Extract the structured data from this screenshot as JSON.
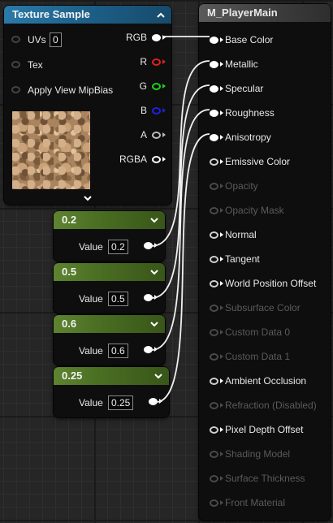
{
  "texture_node": {
    "title": "Texture Sample",
    "inputs": [
      {
        "label": "UVs",
        "value": "0"
      },
      {
        "label": "Tex"
      },
      {
        "label": "Apply View MipBias"
      }
    ],
    "outputs": [
      {
        "label": "RGB",
        "color": "#ffffff"
      },
      {
        "label": "R",
        "color": "#e02020"
      },
      {
        "label": "G",
        "color": "#20d020"
      },
      {
        "label": "B",
        "color": "#2020e0"
      },
      {
        "label": "A",
        "color": "#bbbbbb"
      },
      {
        "label": "RGBA",
        "color": "#ffffff"
      }
    ],
    "header_color": "#1d5f88"
  },
  "constant_nodes": [
    {
      "title": "0.2",
      "value_label": "Value",
      "value": "0.2"
    },
    {
      "title": "0.5",
      "value_label": "Value",
      "value": "0.5"
    },
    {
      "title": "0.6",
      "value_label": "Value",
      "value": "0.6"
    },
    {
      "title": "0.25",
      "value_label": "Value",
      "value": "0.25"
    }
  ],
  "material_node": {
    "title": "M_PlayerMain",
    "pins": [
      {
        "label": "Base Color",
        "state": "connected"
      },
      {
        "label": "Metallic",
        "state": "connected"
      },
      {
        "label": "Specular",
        "state": "connected"
      },
      {
        "label": "Roughness",
        "state": "connected"
      },
      {
        "label": "Anisotropy",
        "state": "connected"
      },
      {
        "label": "Emissive Color",
        "state": "active"
      },
      {
        "label": "Opacity",
        "state": "disabled"
      },
      {
        "label": "Opacity Mask",
        "state": "disabled"
      },
      {
        "label": "Normal",
        "state": "active"
      },
      {
        "label": "Tangent",
        "state": "active"
      },
      {
        "label": "World Position Offset",
        "state": "active"
      },
      {
        "label": "Subsurface Color",
        "state": "disabled"
      },
      {
        "label": "Custom Data 0",
        "state": "disabled"
      },
      {
        "label": "Custom Data 1",
        "state": "disabled"
      },
      {
        "label": "Ambient Occlusion",
        "state": "active"
      },
      {
        "label": "Refraction (Disabled)",
        "state": "disabled"
      },
      {
        "label": "Pixel Depth Offset",
        "state": "active"
      },
      {
        "label": "Shading Model",
        "state": "disabled"
      },
      {
        "label": "Surface Thickness",
        "state": "disabled"
      },
      {
        "label": "Front Material",
        "state": "disabled"
      }
    ]
  },
  "icons": {
    "collapse": "chevron-up-icon",
    "expand": "chevron-down-icon"
  }
}
